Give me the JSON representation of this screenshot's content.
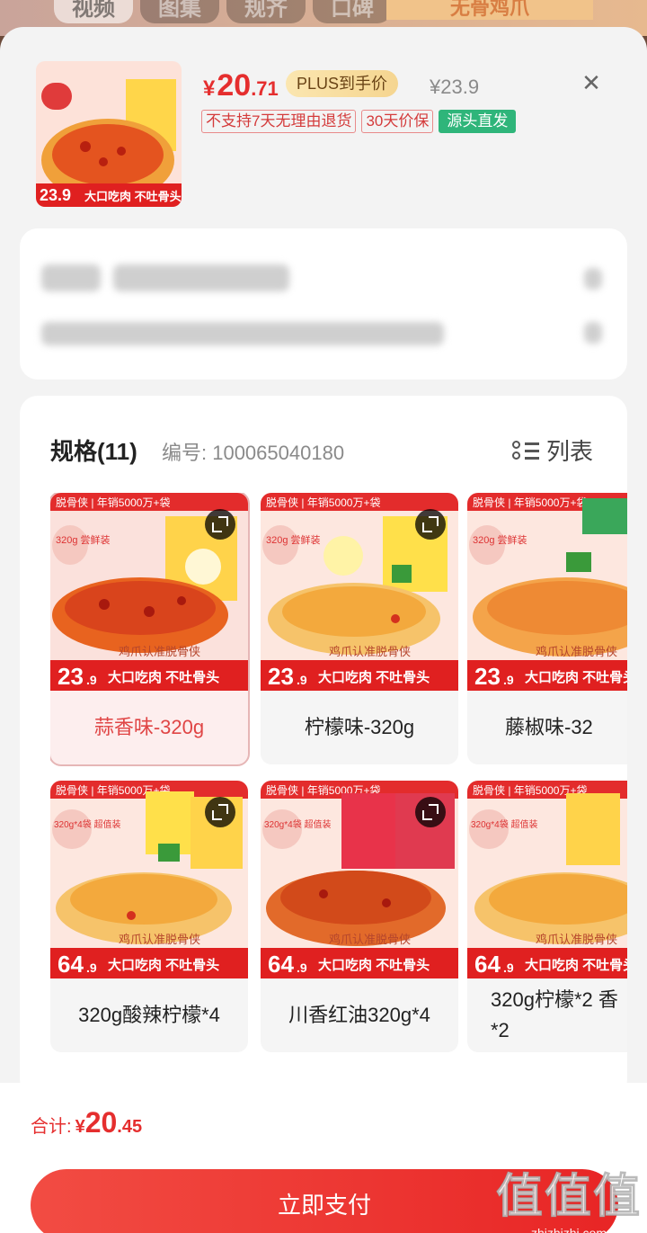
{
  "background": {
    "tabs": [
      "视频",
      "图集",
      "规齐",
      "口碑"
    ],
    "banner": "无骨鸡爪"
  },
  "product": {
    "currency": "¥",
    "price_int": "20",
    "price_dec": ".71",
    "plus_badge": "PLUS到手价",
    "original_price": "¥23.9",
    "tags": [
      "不支持7天无理由退货",
      "30天价保",
      "源头直发"
    ]
  },
  "spec": {
    "title": "规格(11)",
    "number": "编号: 100065040180",
    "list_label": "列表",
    "options": [
      {
        "label": "蒜香味-320g",
        "price_int": "23",
        "price_dec": ".9",
        "pack": "320g 尝鲜装",
        "selected": true
      },
      {
        "label": "柠檬味-320g",
        "price_int": "23",
        "price_dec": ".9",
        "pack": "320g 尝鲜装",
        "selected": false
      },
      {
        "label": "藤椒味-32",
        "price_int": "23",
        "price_dec": ".9",
        "pack": "320g 尝鲜装",
        "selected": false
      },
      {
        "label": "320g酸辣柠檬*4",
        "price_int": "64",
        "price_dec": ".9",
        "pack": "320g*4袋 超值装",
        "selected": false
      },
      {
        "label": "川香红油320g*4",
        "price_int": "64",
        "price_dec": ".9",
        "pack": "320g*4袋 超值装",
        "selected": false
      },
      {
        "label": "320g柠檬*2 香*2",
        "price_int": "64",
        "price_dec": ".9",
        "pack": "320g*4袋 超值装",
        "selected": false
      }
    ],
    "card_slogan_top": "鸡爪认准脱骨侠",
    "card_slogan_bottom": "大口吃肉 不吐骨头",
    "card_brand": "脱骨侠 | 年销5000万+袋"
  },
  "footer": {
    "total_label": "合计:",
    "currency": "¥",
    "total_int": "20",
    "total_dec": ".45",
    "pay_button": "立即支付"
  },
  "watermark": {
    "big": "值值值",
    "small": "zhizhizhi.com"
  },
  "colors": {
    "accent_red": "#e52e2e",
    "green_tag": "#2fb57a",
    "plus_gold": "#f5d590"
  }
}
